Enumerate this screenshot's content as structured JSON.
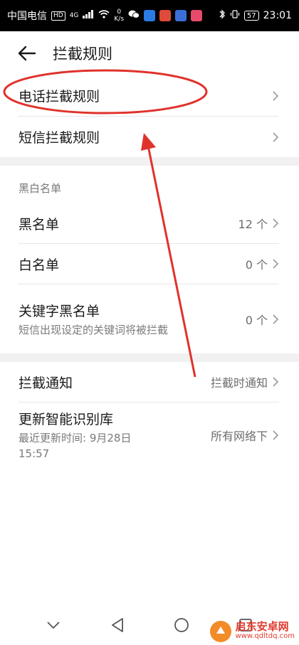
{
  "status_bar": {
    "carrier": "中国电信",
    "hd_badge": "HD",
    "network": "4G",
    "speed_value": "0",
    "speed_unit": "K/s",
    "battery": "57",
    "time": "23:01"
  },
  "header": {
    "back_icon": "arrow-left-icon",
    "title": "拦截规则"
  },
  "rules": {
    "call_rules": "电话拦截规则",
    "sms_rules": "短信拦截规则"
  },
  "blackwhite": {
    "section_label": "黑白名单",
    "blacklist_label": "黑名单",
    "blacklist_value": "12 个",
    "whitelist_label": "白名单",
    "whitelist_value": "0 个",
    "keyword_label": "关键字黑名单",
    "keyword_desc": "短信出现设定的关键词将被拦截",
    "keyword_value": "0 个"
  },
  "notify": {
    "label": "拦截通知",
    "value": "拦截时通知"
  },
  "library": {
    "label": "更新智能识别库",
    "desc": "最近更新时间: 9月28日 15:57",
    "value": "所有网络下"
  },
  "nav": {
    "icons": [
      "chevron-down-icon",
      "back-triangle-icon",
      "home-circle-icon",
      "recents-square-icon"
    ]
  },
  "watermark": {
    "name": "启东安卓网",
    "url": "www.qdltdq.com"
  },
  "colors": {
    "annotation_red": "#e0322b",
    "status_bg": "#000000",
    "section_bg": "#f1f1f1"
  }
}
